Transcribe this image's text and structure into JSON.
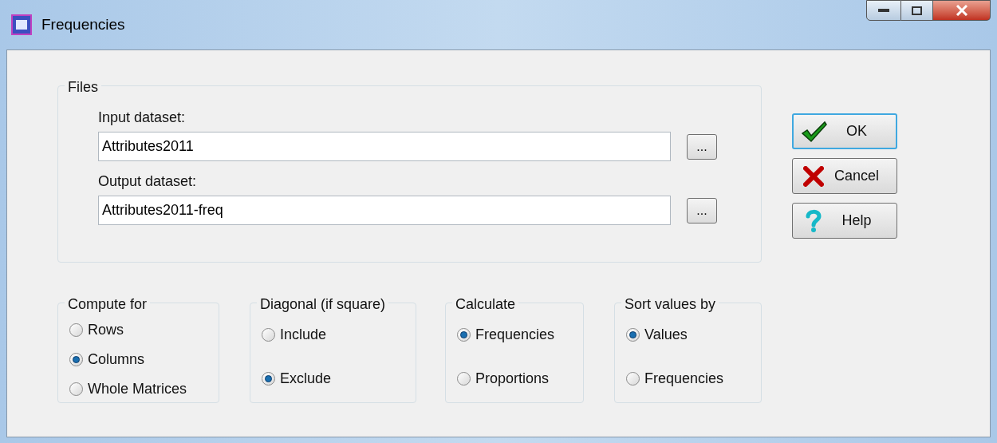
{
  "window": {
    "title": "Frequencies"
  },
  "files": {
    "title": "Files",
    "fields": [
      {
        "label": "Input dataset:",
        "value": "Attributes2011",
        "browse": "..."
      },
      {
        "label": "Output dataset:",
        "value": "Attributes2011-freq",
        "browse": "..."
      }
    ]
  },
  "buttons": [
    {
      "kind": "ok",
      "label": "OK",
      "focused": true
    },
    {
      "kind": "cancel",
      "label": "Cancel",
      "focused": false
    },
    {
      "kind": "help",
      "label": "Help",
      "focused": false
    }
  ],
  "groups": [
    {
      "title": "Compute for",
      "options": [
        {
          "label": "Rows",
          "selected": false
        },
        {
          "label": "Columns",
          "selected": true
        },
        {
          "label": "Whole Matrices",
          "selected": false
        }
      ]
    },
    {
      "title": "Diagonal (if square)",
      "options": [
        {
          "label": "Include",
          "selected": false
        },
        {
          "label": "Exclude",
          "selected": true
        }
      ]
    },
    {
      "title": "Calculate",
      "options": [
        {
          "label": "Frequencies",
          "selected": true
        },
        {
          "label": "Proportions",
          "selected": false
        }
      ]
    },
    {
      "title": "Sort values by",
      "options": [
        {
          "label": "Values",
          "selected": true
        },
        {
          "label": "Frequencies",
          "selected": false
        }
      ]
    }
  ]
}
